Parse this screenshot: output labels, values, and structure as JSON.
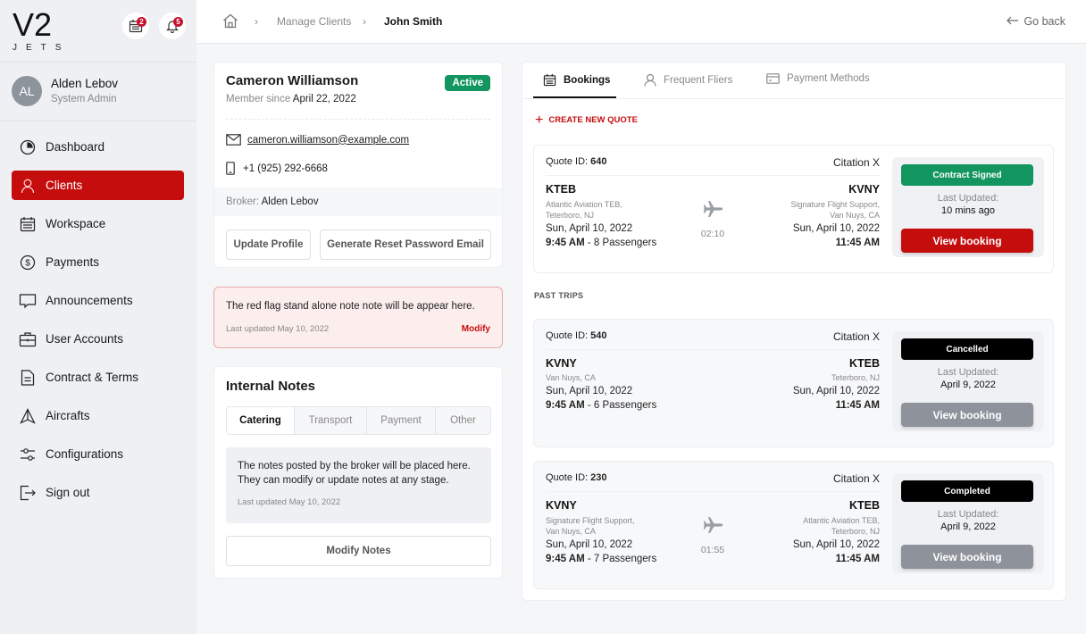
{
  "brand": {
    "logo_main": "V2",
    "logo_sub": "JETS",
    "accent": "#c50d0d"
  },
  "header_icons": [
    {
      "icon": "calendar-icon",
      "badge": "2"
    },
    {
      "icon": "bell-icon",
      "badge": "5"
    }
  ],
  "user": {
    "initials": "AL",
    "name": "Alden Lebov",
    "role": "System Admin"
  },
  "sidebar": {
    "items": [
      {
        "label": "Dashboard",
        "icon": "dashboard-icon",
        "active": false
      },
      {
        "label": "Clients",
        "icon": "user-icon",
        "active": true
      },
      {
        "label": "Workspace",
        "icon": "calendar-icon",
        "active": false
      },
      {
        "label": "Payments",
        "icon": "dollar-icon",
        "active": false
      },
      {
        "label": "Announcements",
        "icon": "chat-icon",
        "active": false
      },
      {
        "label": "User Accounts",
        "icon": "briefcase-icon",
        "active": false
      },
      {
        "label": "Contract & Terms",
        "icon": "document-icon",
        "active": false
      },
      {
        "label": "Aircrafts",
        "icon": "aircraft-icon",
        "active": false
      },
      {
        "label": "Configurations",
        "icon": "sliders-icon",
        "active": false
      },
      {
        "label": "Sign out",
        "icon": "sign-out-icon",
        "active": false
      }
    ]
  },
  "breadcrumb": {
    "parent": "Manage Clients",
    "current": "John Smith"
  },
  "go_back": "Go back",
  "profile": {
    "name": "Cameron Williamson",
    "status": "Active",
    "member_since_label": "Member since",
    "member_since": "April 22, 2022",
    "email": "cameron.williamson@example.com",
    "phone": "+1 (925) 292-6668",
    "broker_label": "Broker:",
    "broker": "Alden Lebov",
    "update_profile": "Update Profile",
    "reset_password": "Generate Reset Password Email"
  },
  "flag_note": {
    "text": "The red flag stand alone note note will be appear here.",
    "updated": "Last updated May 10, 2022",
    "modify": "Modify"
  },
  "internal_notes": {
    "title": "Internal Notes",
    "tabs": [
      "Catering",
      "Transport",
      "Payment",
      "Other"
    ],
    "active_tab": "Catering",
    "body_line1": "The notes posted by the broker will be placed here.",
    "body_line2": "They can modify or update notes at any stage.",
    "updated": "Last updated May 10, 2022",
    "modify_button": "Modify Notes"
  },
  "bookings_panel": {
    "tabs": [
      {
        "label": "Bookings",
        "icon": "calendar-icon",
        "active": true
      },
      {
        "label": "Frequent Fliers",
        "icon": "user-icon",
        "active": false
      },
      {
        "label": "Payment Methods",
        "icon": "card-icon",
        "active": false
      }
    ],
    "create_quote": "CREATE NEW QUOTE",
    "past_trips_label": "PAST TRIPS",
    "quote_id_label": "Quote ID:",
    "last_updated_label": "Last Updated:",
    "view_booking": "View booking",
    "trips": [
      {
        "quote_id": "640",
        "aircraft": "Citation X",
        "from_code": "KTEB",
        "from_fbo_1": "Atlantic Aviation TEB,",
        "from_fbo_2": "Teterboro, NJ",
        "from_date": "Sun, April 10, 2022",
        "from_time": "9:45 AM",
        "passengers": "- 8 Passengers",
        "to_code": "KVNY",
        "to_fbo_1": "Signature Flight Support,",
        "to_fbo_2": "Van Nuys, CA",
        "to_date": "Sun, April 10, 2022",
        "to_time": "11:45 AM",
        "duration": "02:10",
        "status": "Contract Signed",
        "status_color": "#13955f",
        "last_updated": "10 mins ago",
        "button_color": "#c50d0d",
        "past": false
      },
      {
        "quote_id": "540",
        "aircraft": "Citation X",
        "from_code": "KVNY",
        "from_fbo_1": "Van Nuys, CA",
        "from_fbo_2": "",
        "from_date": "Sun, April 10, 2022",
        "from_time": "9:45 AM",
        "passengers": "- 6 Passengers",
        "to_code": "KTEB",
        "to_fbo_1": "Teterboro, NJ",
        "to_fbo_2": "",
        "to_date": "Sun, April 10, 2022",
        "to_time": "11:45 AM",
        "duration": "",
        "status": "Cancelled",
        "status_color": "#000000",
        "last_updated": "April 9, 2022",
        "button_color": "#8e939b",
        "past": true
      },
      {
        "quote_id": "230",
        "aircraft": "Citation X",
        "from_code": "KVNY",
        "from_fbo_1": "Signature Flight Support,",
        "from_fbo_2": "Van Nuys, CA",
        "from_date": "Sun, April 10, 2022",
        "from_time": "9:45 AM",
        "passengers": "- 7 Passengers",
        "to_code": "KTEB",
        "to_fbo_1": "Atlantic Aviation TEB,",
        "to_fbo_2": "Teterboro, NJ",
        "to_date": "Sun, April 10, 2022",
        "to_time": "11:45 AM",
        "duration": "01:55",
        "status": "Completed",
        "status_color": "#000000",
        "last_updated": "April 9, 2022",
        "button_color": "#8e939b",
        "past": true
      }
    ]
  }
}
